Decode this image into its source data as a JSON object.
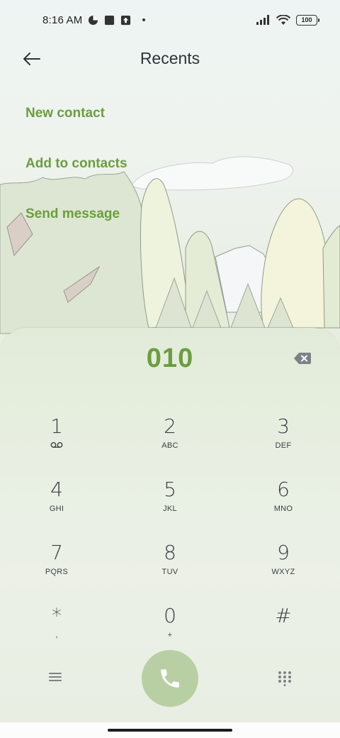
{
  "status_bar": {
    "time": "8:16 AM",
    "battery": "100"
  },
  "header": {
    "title": "Recents",
    "back_icon": "arrow-left-icon"
  },
  "actions": [
    {
      "label": "New contact"
    },
    {
      "label": "Add to contacts"
    },
    {
      "label": "Send message"
    }
  ],
  "dialer": {
    "number": "010",
    "keys": [
      {
        "digit": "1",
        "letters": ""
      },
      {
        "digit": "2",
        "letters": "ABC"
      },
      {
        "digit": "3",
        "letters": "DEF"
      },
      {
        "digit": "4",
        "letters": "GHI"
      },
      {
        "digit": "5",
        "letters": "JKL"
      },
      {
        "digit": "6",
        "letters": "MNO"
      },
      {
        "digit": "7",
        "letters": "PQRS"
      },
      {
        "digit": "8",
        "letters": "TUV"
      },
      {
        "digit": "9",
        "letters": "WXYZ"
      },
      {
        "digit": "*",
        "letters": ","
      },
      {
        "digit": "0",
        "letters": "+"
      },
      {
        "digit": "#",
        "letters": ""
      }
    ]
  },
  "colors": {
    "accent": "#6a9e3e",
    "call_button": "#b8cfa3"
  }
}
